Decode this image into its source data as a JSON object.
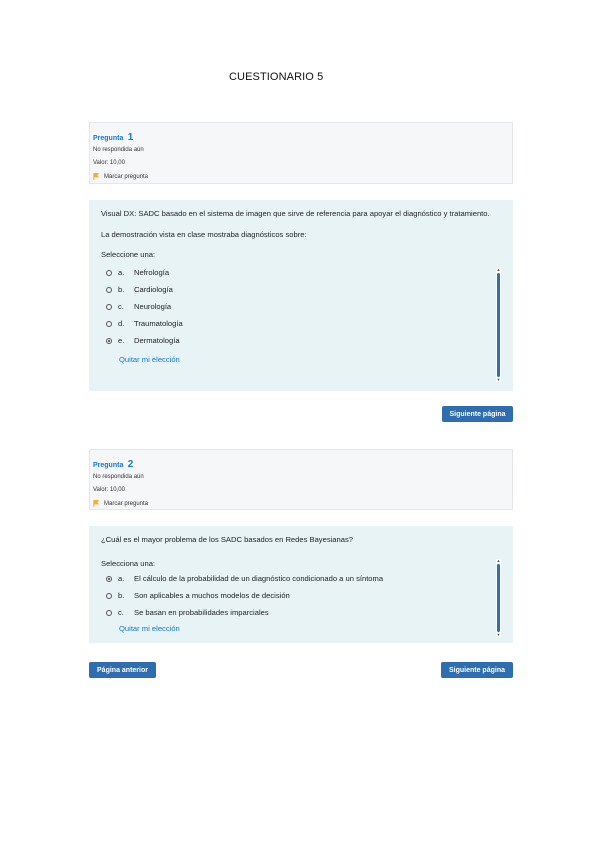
{
  "doc_title": "CUESTIONARIO 5",
  "q1": {
    "label": "Pregunta",
    "number": "1",
    "status": "No respondida aún",
    "value": "Valor: 10,00",
    "flag": "Marcar pregunta",
    "text1": "Visual DX: SADC basado en el sistema de imagen que sirve de referencia para apoyar el diagnóstico y tratamiento.",
    "text2": "La demostración vista en clase mostraba diagnósticos sobre:",
    "prompt": "Seleccione una:",
    "options": [
      {
        "letter": "a.",
        "text": "Nefrología"
      },
      {
        "letter": "b.",
        "text": "Cardiología"
      },
      {
        "letter": "c.",
        "text": "Neurología"
      },
      {
        "letter": "d.",
        "text": "Traumatología"
      },
      {
        "letter": "e.",
        "text": "Dermatología"
      }
    ],
    "selected": "e",
    "clear": "Quitar mi elección"
  },
  "q2": {
    "label": "Pregunta",
    "number": "2",
    "status": "No respondida aún",
    "value": "Valor: 10,00",
    "flag": "Marcar pregunta",
    "text1": "¿Cuál es el mayor problema de los SADC basados en Redes Bayesianas?",
    "prompt": "Selecciona una:",
    "options": [
      {
        "letter": "a.",
        "text": "El cálculo de la probabilidad de un diagnóstico condicionado a un síntoma"
      },
      {
        "letter": "b.",
        "text": "Son aplicables a muchos modelos de decisión"
      },
      {
        "letter": "c.",
        "text": "Se basan en probabilidades imparciales"
      }
    ],
    "selected": "a",
    "clear": "Quitar mi elección"
  },
  "buttons": {
    "next": "Siguiente página",
    "prev": "Página anterior"
  },
  "colors": {
    "accent": "#2d6db0",
    "link": "#1177d1",
    "content_bg": "#e7f3f5",
    "info_bg": "#f6f7f9"
  }
}
